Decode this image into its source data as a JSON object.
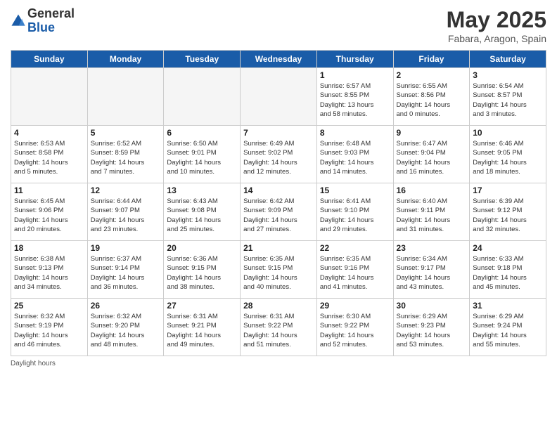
{
  "logo": {
    "general": "General",
    "blue": "Blue"
  },
  "title": "May 2025",
  "subtitle": "Fabara, Aragon, Spain",
  "days_of_week": [
    "Sunday",
    "Monday",
    "Tuesday",
    "Wednesday",
    "Thursday",
    "Friday",
    "Saturday"
  ],
  "footer": "Daylight hours",
  "weeks": [
    [
      {
        "day": "",
        "info": ""
      },
      {
        "day": "",
        "info": ""
      },
      {
        "day": "",
        "info": ""
      },
      {
        "day": "",
        "info": ""
      },
      {
        "day": "1",
        "info": "Sunrise: 6:57 AM\nSunset: 8:55 PM\nDaylight: 13 hours\nand 58 minutes."
      },
      {
        "day": "2",
        "info": "Sunrise: 6:55 AM\nSunset: 8:56 PM\nDaylight: 14 hours\nand 0 minutes."
      },
      {
        "day": "3",
        "info": "Sunrise: 6:54 AM\nSunset: 8:57 PM\nDaylight: 14 hours\nand 3 minutes."
      }
    ],
    [
      {
        "day": "4",
        "info": "Sunrise: 6:53 AM\nSunset: 8:58 PM\nDaylight: 14 hours\nand 5 minutes."
      },
      {
        "day": "5",
        "info": "Sunrise: 6:52 AM\nSunset: 8:59 PM\nDaylight: 14 hours\nand 7 minutes."
      },
      {
        "day": "6",
        "info": "Sunrise: 6:50 AM\nSunset: 9:01 PM\nDaylight: 14 hours\nand 10 minutes."
      },
      {
        "day": "7",
        "info": "Sunrise: 6:49 AM\nSunset: 9:02 PM\nDaylight: 14 hours\nand 12 minutes."
      },
      {
        "day": "8",
        "info": "Sunrise: 6:48 AM\nSunset: 9:03 PM\nDaylight: 14 hours\nand 14 minutes."
      },
      {
        "day": "9",
        "info": "Sunrise: 6:47 AM\nSunset: 9:04 PM\nDaylight: 14 hours\nand 16 minutes."
      },
      {
        "day": "10",
        "info": "Sunrise: 6:46 AM\nSunset: 9:05 PM\nDaylight: 14 hours\nand 18 minutes."
      }
    ],
    [
      {
        "day": "11",
        "info": "Sunrise: 6:45 AM\nSunset: 9:06 PM\nDaylight: 14 hours\nand 20 minutes."
      },
      {
        "day": "12",
        "info": "Sunrise: 6:44 AM\nSunset: 9:07 PM\nDaylight: 14 hours\nand 23 minutes."
      },
      {
        "day": "13",
        "info": "Sunrise: 6:43 AM\nSunset: 9:08 PM\nDaylight: 14 hours\nand 25 minutes."
      },
      {
        "day": "14",
        "info": "Sunrise: 6:42 AM\nSunset: 9:09 PM\nDaylight: 14 hours\nand 27 minutes."
      },
      {
        "day": "15",
        "info": "Sunrise: 6:41 AM\nSunset: 9:10 PM\nDaylight: 14 hours\nand 29 minutes."
      },
      {
        "day": "16",
        "info": "Sunrise: 6:40 AM\nSunset: 9:11 PM\nDaylight: 14 hours\nand 31 minutes."
      },
      {
        "day": "17",
        "info": "Sunrise: 6:39 AM\nSunset: 9:12 PM\nDaylight: 14 hours\nand 32 minutes."
      }
    ],
    [
      {
        "day": "18",
        "info": "Sunrise: 6:38 AM\nSunset: 9:13 PM\nDaylight: 14 hours\nand 34 minutes."
      },
      {
        "day": "19",
        "info": "Sunrise: 6:37 AM\nSunset: 9:14 PM\nDaylight: 14 hours\nand 36 minutes."
      },
      {
        "day": "20",
        "info": "Sunrise: 6:36 AM\nSunset: 9:15 PM\nDaylight: 14 hours\nand 38 minutes."
      },
      {
        "day": "21",
        "info": "Sunrise: 6:35 AM\nSunset: 9:15 PM\nDaylight: 14 hours\nand 40 minutes."
      },
      {
        "day": "22",
        "info": "Sunrise: 6:35 AM\nSunset: 9:16 PM\nDaylight: 14 hours\nand 41 minutes."
      },
      {
        "day": "23",
        "info": "Sunrise: 6:34 AM\nSunset: 9:17 PM\nDaylight: 14 hours\nand 43 minutes."
      },
      {
        "day": "24",
        "info": "Sunrise: 6:33 AM\nSunset: 9:18 PM\nDaylight: 14 hours\nand 45 minutes."
      }
    ],
    [
      {
        "day": "25",
        "info": "Sunrise: 6:32 AM\nSunset: 9:19 PM\nDaylight: 14 hours\nand 46 minutes."
      },
      {
        "day": "26",
        "info": "Sunrise: 6:32 AM\nSunset: 9:20 PM\nDaylight: 14 hours\nand 48 minutes."
      },
      {
        "day": "27",
        "info": "Sunrise: 6:31 AM\nSunset: 9:21 PM\nDaylight: 14 hours\nand 49 minutes."
      },
      {
        "day": "28",
        "info": "Sunrise: 6:31 AM\nSunset: 9:22 PM\nDaylight: 14 hours\nand 51 minutes."
      },
      {
        "day": "29",
        "info": "Sunrise: 6:30 AM\nSunset: 9:22 PM\nDaylight: 14 hours\nand 52 minutes."
      },
      {
        "day": "30",
        "info": "Sunrise: 6:29 AM\nSunset: 9:23 PM\nDaylight: 14 hours\nand 53 minutes."
      },
      {
        "day": "31",
        "info": "Sunrise: 6:29 AM\nSunset: 9:24 PM\nDaylight: 14 hours\nand 55 minutes."
      }
    ]
  ]
}
